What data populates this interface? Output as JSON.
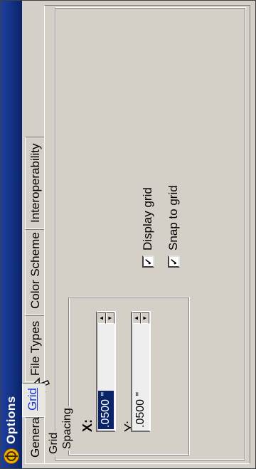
{
  "window": {
    "title": "Options"
  },
  "tabs": [
    {
      "label": "General",
      "active": false
    },
    {
      "label": "Grid",
      "active": true
    },
    {
      "label": "File Types",
      "active": false
    },
    {
      "label": "Color Scheme",
      "active": false
    },
    {
      "label": "Interoperability",
      "active": false
    }
  ],
  "grid_group": {
    "label": "Grid",
    "spacing": {
      "label": "Spacing",
      "x": {
        "label": "X:",
        "value": ".0500 \""
      },
      "y": {
        "label": "Y:",
        "value": ".0500 \""
      }
    },
    "display_grid": {
      "label": "Display grid",
      "checked": true
    },
    "snap_to_grid": {
      "label": "Snap to grid",
      "checked": true
    }
  },
  "colors": {
    "titlebar": "#0a246a",
    "dialog_bg": "#d4d0c8",
    "active_tab_text": "#1a3ad6",
    "selection": "#0a246a"
  }
}
